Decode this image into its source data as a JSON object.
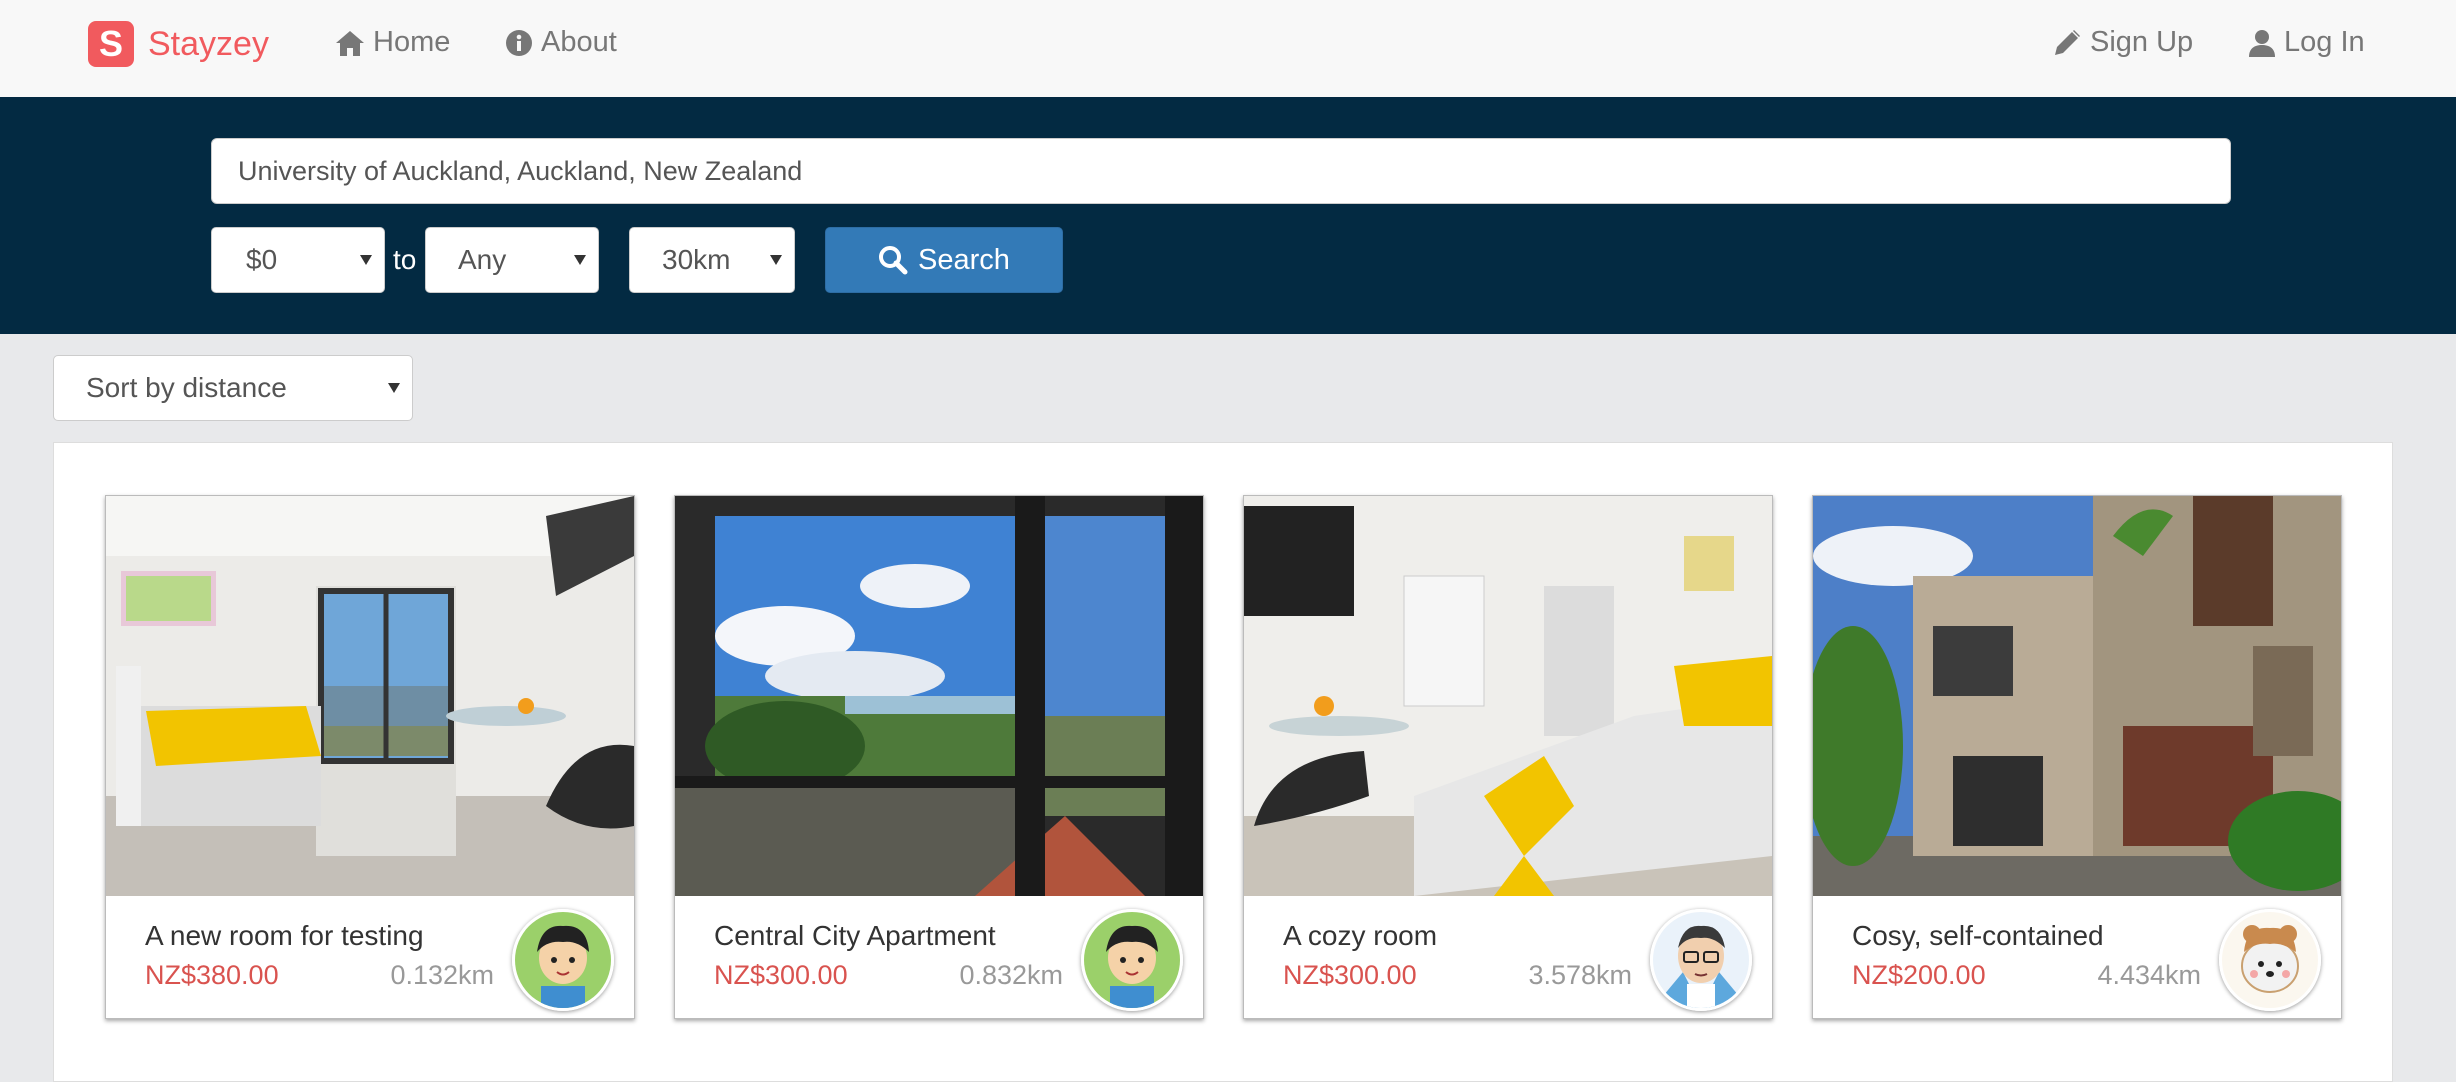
{
  "brand": {
    "logo_letter": "S",
    "name": "Stayzey",
    "color": "#f15a5e"
  },
  "nav": {
    "home": "Home",
    "about": "About",
    "signup": "Sign Up",
    "login": "Log In"
  },
  "search": {
    "location": "University of Auckland, Auckland, New Zealand",
    "price_min": "$0",
    "to_label": "to",
    "price_max": "Any",
    "distance": "30km",
    "button": "Search"
  },
  "sort": {
    "selected": "Sort by distance"
  },
  "listings": [
    {
      "title": "A new room for testing",
      "price": "NZ$380.00",
      "distance": "0.132km",
      "avatar_icon": "user-avatar-boy-icon"
    },
    {
      "title": "Central City Apartment",
      "price": "NZ$300.00",
      "distance": "0.832km",
      "avatar_icon": "user-avatar-boy-icon"
    },
    {
      "title": "A cozy room",
      "price": "NZ$300.00",
      "distance": "3.578km",
      "avatar_icon": "user-avatar-glasses-icon"
    },
    {
      "title": "Cosy, self-contained",
      "price": "NZ$200.00",
      "distance": "4.434km",
      "avatar_icon": "user-avatar-dog-icon"
    }
  ],
  "colors": {
    "navbar": "#f8f8f8",
    "search_band": "#032a42",
    "button": "#337ab7",
    "price": "#d9534f"
  }
}
